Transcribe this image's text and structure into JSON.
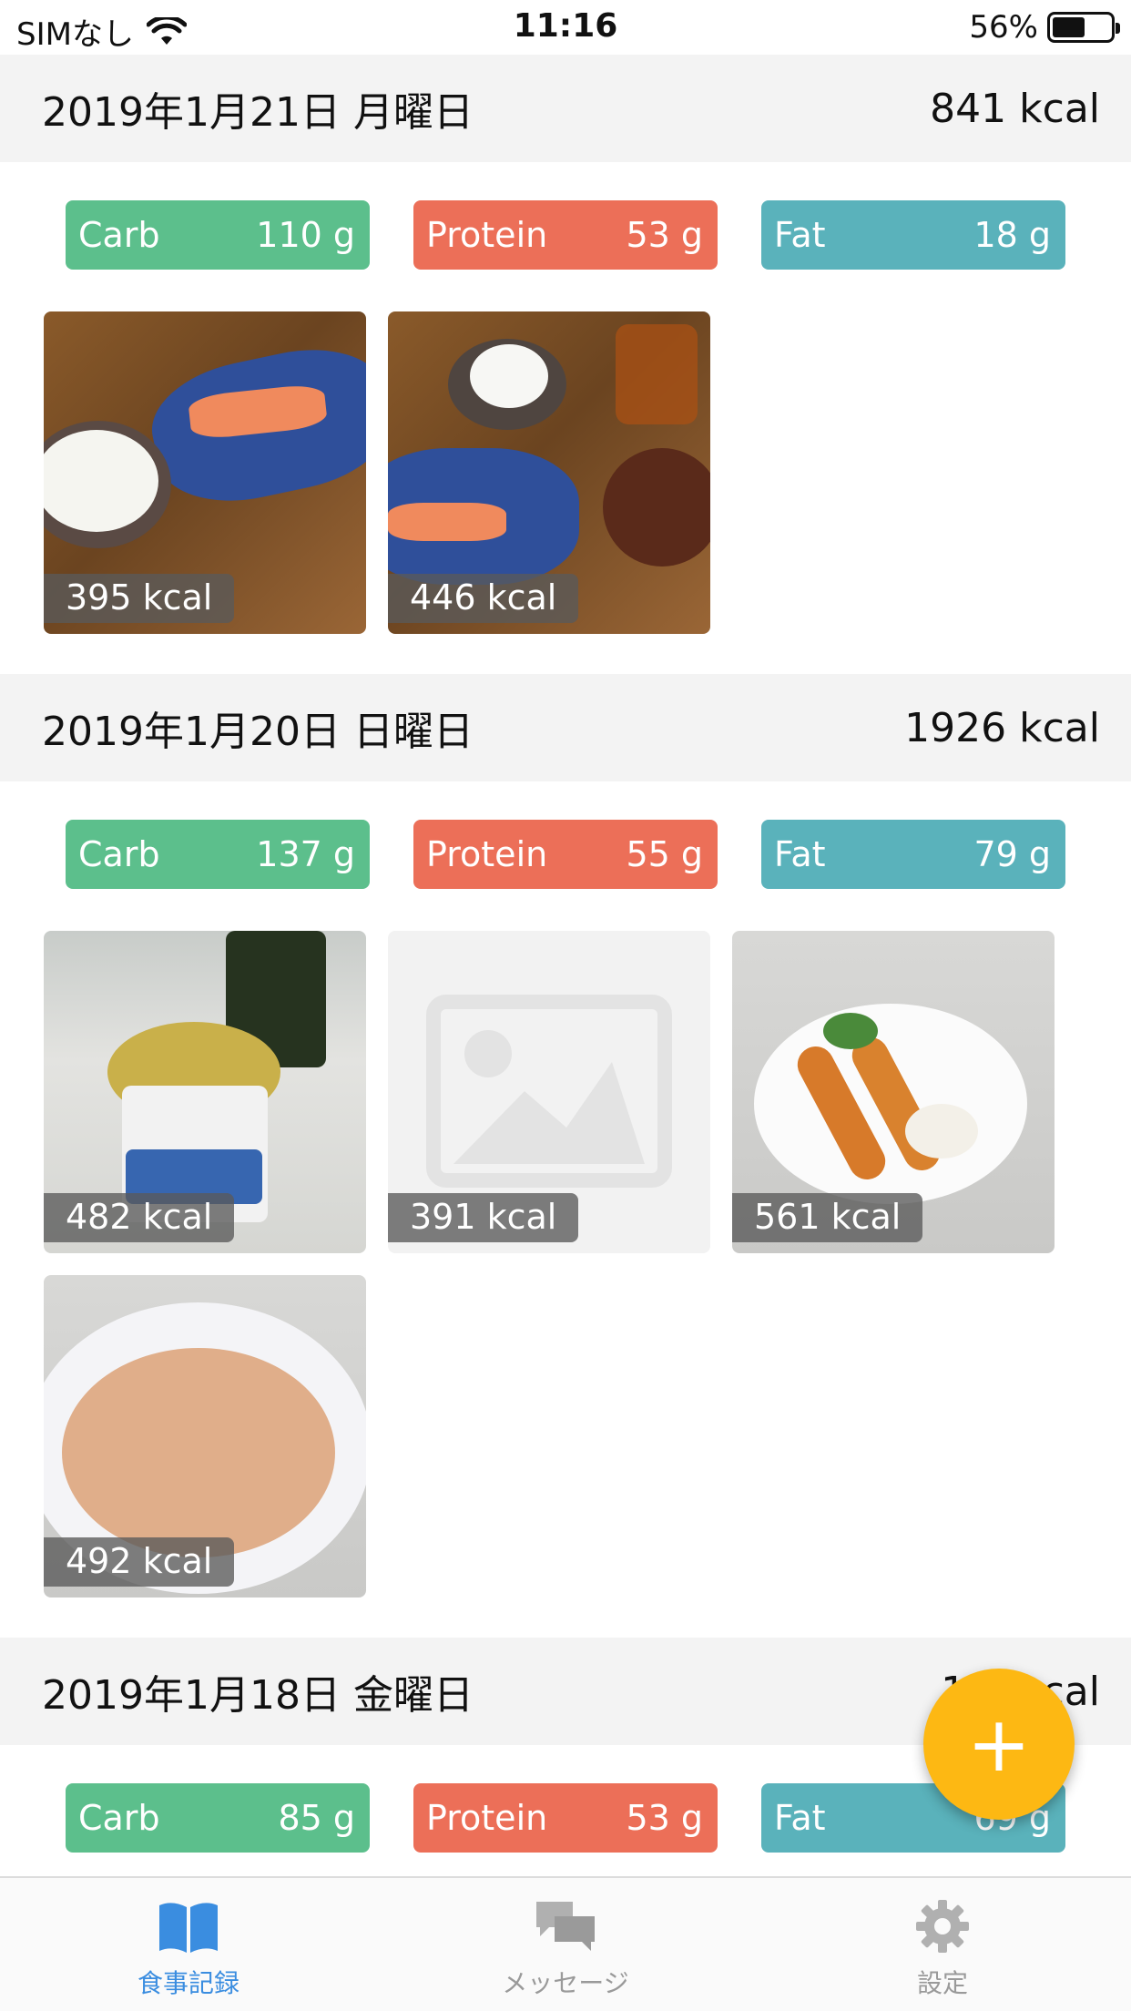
{
  "status_bar": {
    "carrier": "SIMなし",
    "time": "11:16",
    "battery": "56%",
    "battery_level": 0.56
  },
  "days": [
    {
      "date": "2019年1月21日 月曜日",
      "total": "841 kcal",
      "macros": [
        {
          "label": "Carb",
          "value": "110 g"
        },
        {
          "label": "Protein",
          "value": "53 g"
        },
        {
          "label": "Fat",
          "value": "18 g"
        }
      ],
      "meals": [
        {
          "kcal": "395 kcal"
        },
        {
          "kcal": "446 kcal"
        }
      ]
    },
    {
      "date": "2019年1月20日 日曜日",
      "total": "1926 kcal",
      "macros": [
        {
          "label": "Carb",
          "value": "137 g"
        },
        {
          "label": "Protein",
          "value": "55 g"
        },
        {
          "label": "Fat",
          "value": "79 g"
        }
      ],
      "meals": [
        {
          "kcal": "482 kcal"
        },
        {
          "kcal": "391 kcal"
        },
        {
          "kcal": "561 kcal"
        },
        {
          "kcal": "492 kcal"
        }
      ]
    },
    {
      "date": "2019年1月18日 金曜日",
      "total": "1… kcal",
      "macros": [
        {
          "label": "Carb",
          "value": "85 g"
        },
        {
          "label": "Protein",
          "value": "53 g"
        },
        {
          "label": "Fat",
          "value": "69 g"
        }
      ]
    }
  ],
  "fab": {
    "symbol": "+"
  },
  "tabs": [
    {
      "label": "食事記録",
      "icon": "book-icon"
    },
    {
      "label": "メッセージ",
      "icon": "chat-bubbles-icon"
    },
    {
      "label": "設定",
      "icon": "gear-icon"
    }
  ],
  "colors": {
    "carb": "#5cbf8c",
    "protein": "#ec6f58",
    "fat": "#5ab2bb",
    "fab": "#fdb813",
    "tab_active": "#3a8de0"
  }
}
